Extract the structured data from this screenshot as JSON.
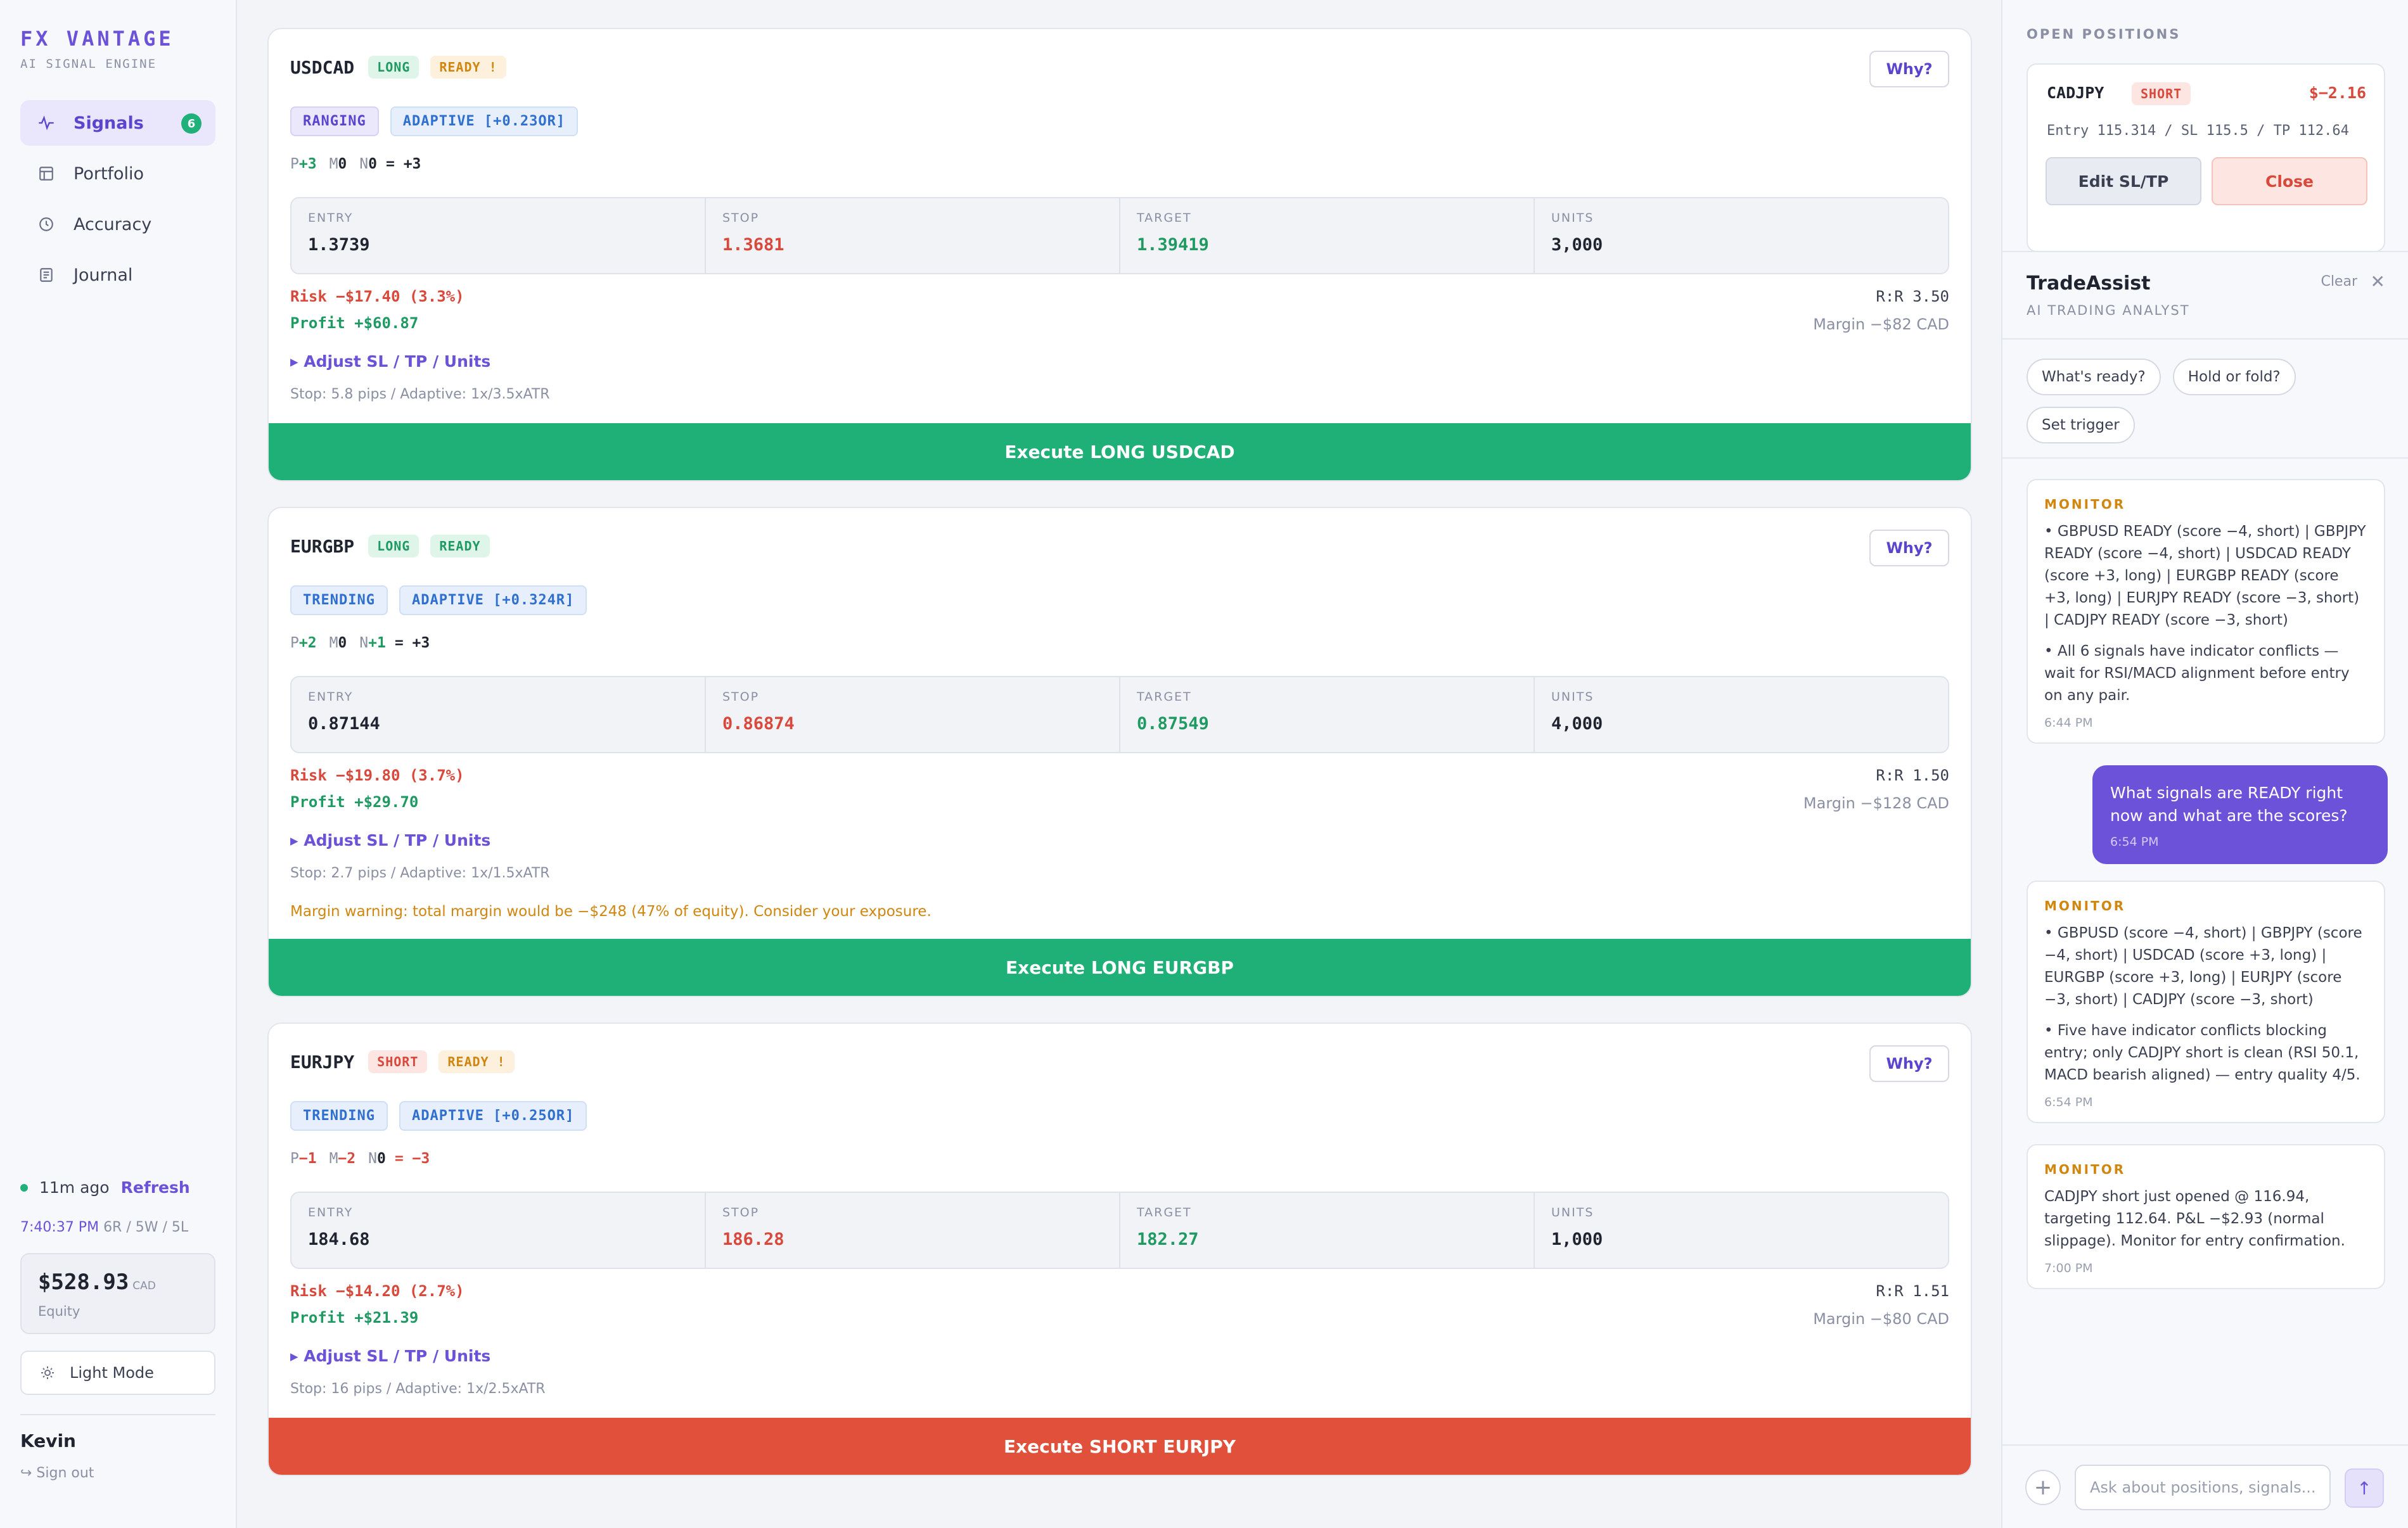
{
  "brand": {
    "name": "FX VANTAGE",
    "subtitle": "AI SIGNAL ENGINE"
  },
  "nav": [
    {
      "label": "Signals",
      "icon": "pulse-icon",
      "active": true,
      "badge": "6"
    },
    {
      "label": "Portfolio",
      "icon": "portfolio-icon"
    },
    {
      "label": "Accuracy",
      "icon": "clock-icon"
    },
    {
      "label": "Journal",
      "icon": "journal-icon"
    }
  ],
  "status": {
    "updated": "11m ago",
    "refresh": "Refresh",
    "time": "7:40:37 PM",
    "record": "6R / 5W / 5L"
  },
  "equity": {
    "value": "$528.93",
    "currency": "CAD",
    "label": "Equity"
  },
  "mode": {
    "label": "Light Mode",
    "icon": "sun-icon"
  },
  "user": {
    "name": "Kevin",
    "signout": "↪ Sign out"
  },
  "labels": {
    "entry": "ENTRY",
    "stop": "STOP",
    "target": "TARGET",
    "units": "UNITS",
    "why": "Why?",
    "adjust": "▸ Adjust SL / TP / Units"
  },
  "signals": [
    {
      "pair": "USDCAD",
      "direction": "LONG",
      "status": "READY !",
      "regime": "RANGING",
      "adaptive": "ADAPTIVE [+0.23OR]",
      "score": {
        "p_label": "P",
        "p": "+3",
        "m_label": "M",
        "m": "0",
        "n_label": "N",
        "n": "0",
        "total": "= +3"
      },
      "entry": "1.3739",
      "stop": "1.3681",
      "target": "1.39419",
      "units": "3,000",
      "risk": "Risk −$17.40 (3.3%)",
      "profit": "Profit +$60.87",
      "rr": "R:R 3.50",
      "margin": "Margin −$82 CAD",
      "stop_info": "Stop: 5.8 pips / Adaptive: 1x/3.5xATR",
      "warning": "",
      "execute": "Execute LONG USDCAD"
    },
    {
      "pair": "EURGBP",
      "direction": "LONG",
      "status": "READY",
      "regime": "TRENDING",
      "adaptive": "ADAPTIVE [+0.324R]",
      "score": {
        "p_label": "P",
        "p": "+2",
        "m_label": "M",
        "m": "0",
        "n_label": "N",
        "n": "+1",
        "total": "= +3"
      },
      "entry": "0.87144",
      "stop": "0.86874",
      "target": "0.87549",
      "units": "4,000",
      "risk": "Risk −$19.80 (3.7%)",
      "profit": "Profit +$29.70",
      "rr": "R:R 1.50",
      "margin": "Margin −$128 CAD",
      "stop_info": "Stop: 2.7 pips / Adaptive: 1x/1.5xATR",
      "warning": "Margin warning: total margin would be −$248 (47% of equity). Consider your exposure.",
      "execute": "Execute LONG EURGBP"
    },
    {
      "pair": "EURJPY",
      "direction": "SHORT",
      "status": "READY !",
      "regime": "TRENDING",
      "adaptive": "ADAPTIVE [+0.25OR]",
      "score": {
        "p_label": "P",
        "p": "−1",
        "m_label": "M",
        "m": "−2",
        "n_label": "N",
        "n": "0",
        "total": "= −3"
      },
      "entry": "184.68",
      "stop": "186.28",
      "target": "182.27",
      "units": "1,000",
      "risk": "Risk −$14.20 (2.7%)",
      "profit": "Profit +$21.39",
      "rr": "R:R 1.51",
      "margin": "Margin −$80 CAD",
      "stop_info": "Stop: 16 pips / Adaptive: 1x/2.5xATR",
      "warning": "",
      "execute": "Execute SHORT EURJPY"
    }
  ],
  "open_positions": {
    "title": "OPEN POSITIONS",
    "items": [
      {
        "pair": "CADJPY",
        "direction": "SHORT",
        "pnl": "$−2.16",
        "detail": "Entry 115.314 / SL 115.5 / TP 112.64",
        "edit": "Edit SL/TP",
        "close": "Close"
      }
    ]
  },
  "assistant": {
    "title": "TradeAssist",
    "subtitle": "AI TRADING ANALYST",
    "clear": "Clear",
    "close": "✕",
    "chips": [
      "What's ready?",
      "Hold or fold?",
      "Set trigger"
    ],
    "messages": [
      {
        "label": "MONITOR",
        "paras": [
          "• GBPUSD READY (score −4, short) | GBPJPY READY (score −4, short) | USDCAD READY (score +3, long) | EURGBP READY (score +3, long) | EURJPY READY (score −3, short) | CADJPY READY (score −3, short)",
          "• All 6 signals have indicator conflicts — wait for RSI/MACD alignment before entry on any pair."
        ],
        "time": "6:44 PM"
      },
      {
        "user": true,
        "text": "What signals are READY right now and what are the scores?",
        "time": "6:54 PM"
      },
      {
        "label": "MONITOR",
        "paras": [
          "• GBPUSD (score −4, short) | GBPJPY (score −4, short) | USDCAD (score +3, long) | EURGBP (score +3, long) | EURJPY (score −3, short) | CADJPY (score −3, short)",
          "• Five have indicator conflicts blocking entry; only CADJPY short is clean (RSI 50.1, MACD bearish aligned) — entry quality 4/5."
        ],
        "time": "6:54 PM"
      },
      {
        "label": "MONITOR",
        "paras": [
          "CADJPY short just opened @ 116.94, targeting 112.64. P&L −$2.93 (normal slippage). Monitor for entry confirmation."
        ],
        "time": "7:00 PM"
      }
    ],
    "input_placeholder": "Ask about positions, signals...",
    "send": "↑",
    "plus": "+"
  },
  "colors": {
    "accent": "#6b52d8",
    "long": "#1fb077",
    "short": "#e0503a",
    "warn": "#d0860f"
  }
}
